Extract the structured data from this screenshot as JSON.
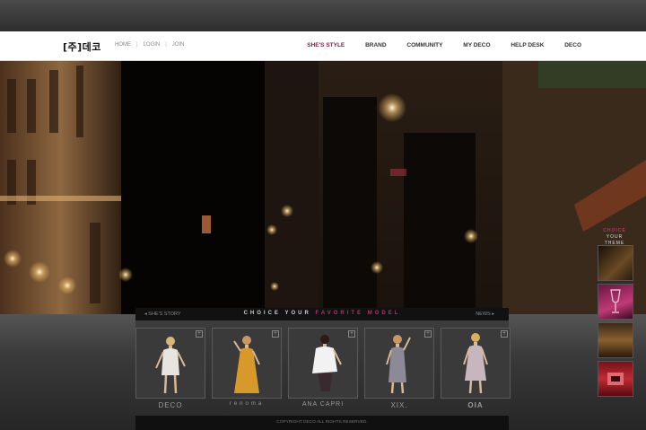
{
  "header": {
    "logo": "[주]데코",
    "util_nav": [
      "HOME",
      "LOGIN",
      "JOIN"
    ],
    "main_nav": [
      {
        "label": "SHE'S STYLE",
        "active": true
      },
      {
        "label": "BRAND",
        "active": false
      },
      {
        "label": "COMMUNITY",
        "active": false
      },
      {
        "label": "MY DECO",
        "active": false
      },
      {
        "label": "HELP DESK",
        "active": false
      },
      {
        "label": "DECO",
        "active": false
      }
    ],
    "accent_color": "#8a1a4a"
  },
  "panel": {
    "left_link": "◂ SHE'S STORY",
    "title_part1": "CHOICE  YOUR ",
    "title_part2": "FAVORITE MODEL",
    "right_link": "NEWS ▸",
    "models": [
      {
        "brand": "DECO",
        "dress_color": "#e8e4df"
      },
      {
        "brand": "renoma",
        "dress_color": "#d79a2a"
      },
      {
        "brand": "ANA CAPRI",
        "dress_color": "#f2f2f2"
      },
      {
        "brand": "XIX.",
        "dress_color": "#8c8a96"
      },
      {
        "brand": "OIA",
        "dress_color": "#c7b6bd"
      }
    ],
    "copyright": "COPYRIGHT DECO ALL RIGHTS RESERVED."
  },
  "sidebar": {
    "title_line1": "CHOICE",
    "title_line2": "YOUR THEME",
    "thumbs": [
      "night-street",
      "wine-glass",
      "restaurant-interior",
      "red-room"
    ]
  }
}
